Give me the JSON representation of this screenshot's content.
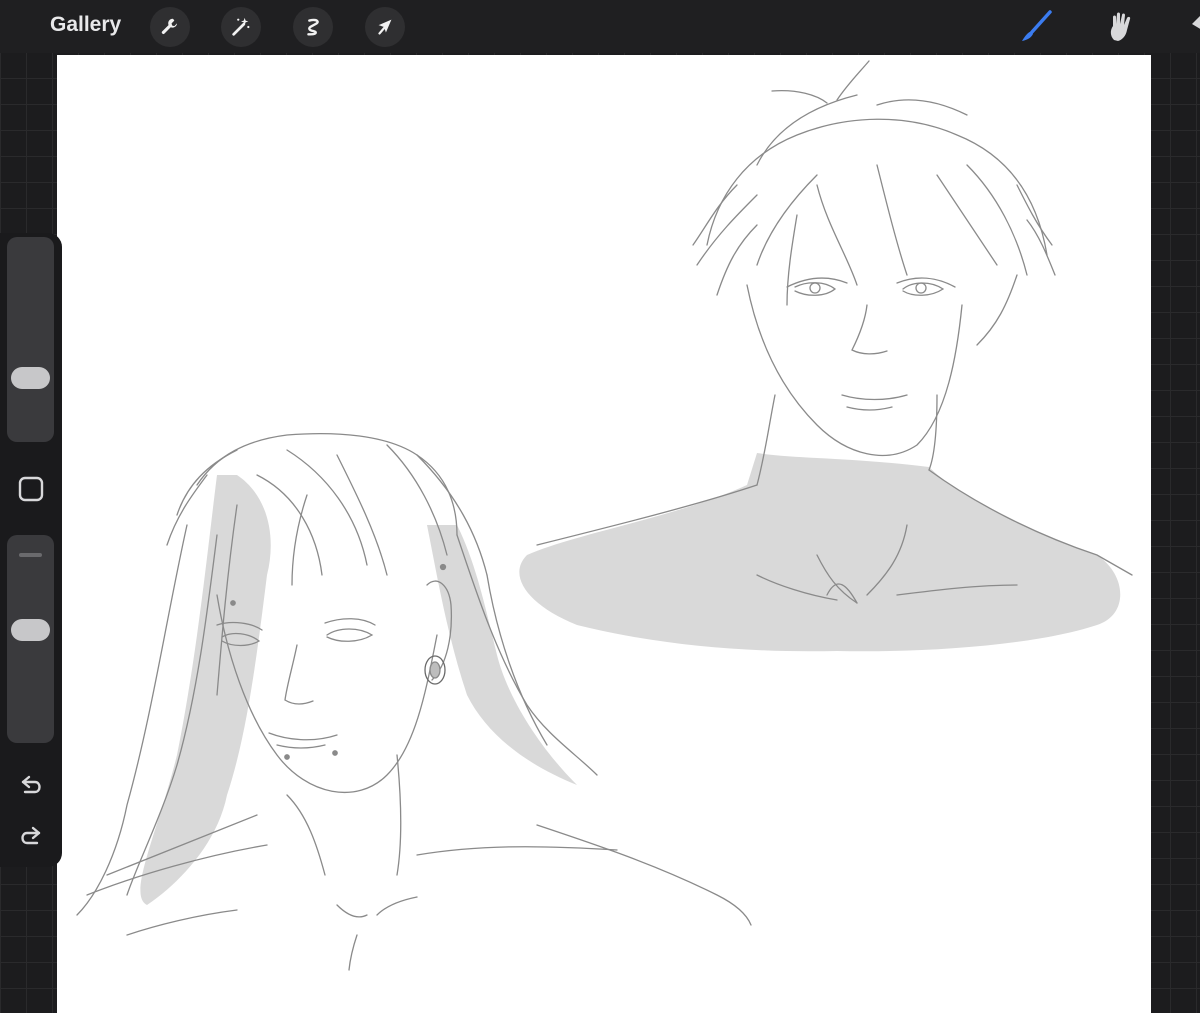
{
  "topbar": {
    "gallery_label": "Gallery",
    "left_tools": [
      {
        "icon": "wrench-icon",
        "name": "actions"
      },
      {
        "icon": "magic-wand-icon",
        "name": "adjustments"
      },
      {
        "icon": "selection-icon",
        "name": "selection"
      },
      {
        "icon": "arrow-cursor-icon",
        "name": "transform"
      }
    ],
    "right_tools": [
      {
        "icon": "brush-icon",
        "name": "brush",
        "active": true
      },
      {
        "icon": "smudge-icon",
        "name": "smudge"
      }
    ]
  },
  "sidebar": {
    "brush_size_level": 0.28,
    "opacity_level": 0.55,
    "modify_button_icon": "square-icon",
    "undo_icon": "undo-icon",
    "redo_icon": "redo-icon"
  },
  "colors": {
    "accent": "#3b7cf0",
    "canvas": "#ffffff",
    "chrome": "#1f1f21",
    "sketch_line": "#8a8a8a",
    "sketch_fill": "#d9d9d9"
  }
}
